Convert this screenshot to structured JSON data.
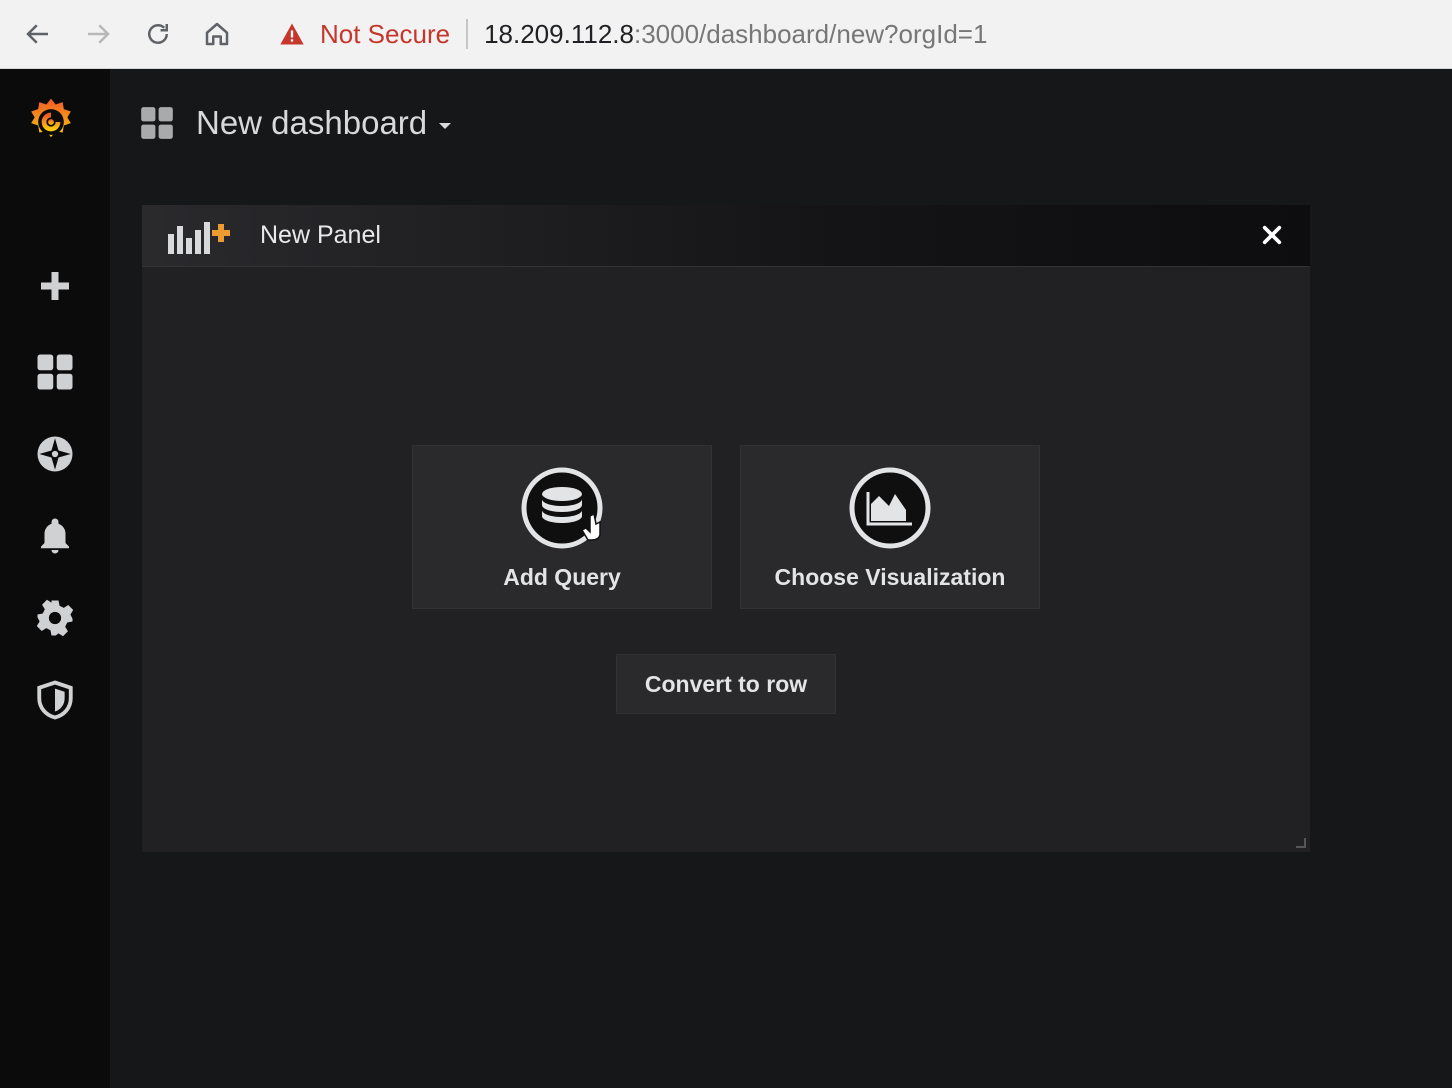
{
  "browser": {
    "security_label": "Not Secure",
    "url_host": "18.209.112.8",
    "url_path": ":3000/dashboard/new?orgId=1"
  },
  "sidebar": {
    "icons": [
      "grafana-logo-icon",
      "plus-icon",
      "dashboards-icon",
      "explore-compass-icon",
      "alerting-bell-icon",
      "configuration-gear-icon",
      "server-admin-shield-icon"
    ],
    "brand_colors": [
      "#f05a28",
      "#fbca0a"
    ]
  },
  "header": {
    "dashboard_title": "New dashboard"
  },
  "panel": {
    "title": "New Panel",
    "add_query_label": "Add Query",
    "choose_visualization_label": "Choose Visualization",
    "convert_to_row_label": "Convert to row"
  }
}
